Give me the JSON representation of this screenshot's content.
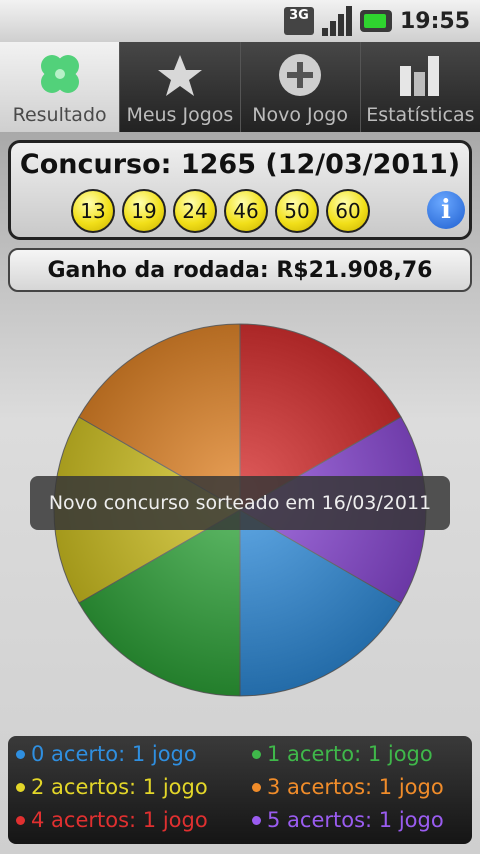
{
  "status_bar": {
    "network": "3G",
    "time": "19:55"
  },
  "tabs": [
    {
      "label": "Resultado",
      "icon": "clover-icon",
      "active": true
    },
    {
      "label": "Meus Jogos",
      "icon": "star-icon",
      "active": false
    },
    {
      "label": "Novo Jogo",
      "icon": "plus-icon",
      "active": false
    },
    {
      "label": "Estatísticas",
      "icon": "bar-chart-icon",
      "active": false
    }
  ],
  "result": {
    "concurso": "Concurso: 1265 (12/03/2011)",
    "numbers": [
      "13",
      "19",
      "24",
      "46",
      "50",
      "60"
    ],
    "ganho": "Ganho da rodada: R$21.908,76"
  },
  "toast": "Novo concurso sorteado em 16/03/2011",
  "chart_data": {
    "type": "pie",
    "categories": [
      "0 acerto",
      "1 acerto",
      "2 acertos",
      "3 acertos",
      "4 acertos",
      "5 acertos"
    ],
    "values": [
      1,
      1,
      1,
      1,
      1,
      1
    ],
    "colors": [
      "#2f8fe0",
      "#2fa83a",
      "#d4c51e",
      "#e07f1e",
      "#d42424",
      "#8a46d8"
    ]
  },
  "legend": [
    {
      "text": "0 acerto: 1 jogo",
      "color": "#2f8fe0"
    },
    {
      "text": "1 acerto: 1 jogo",
      "color": "#3fb84a"
    },
    {
      "text": "2 acertos: 1 jogo",
      "color": "#e3d629"
    },
    {
      "text": "3 acertos: 1 jogo",
      "color": "#f08c2a"
    },
    {
      "text": "4 acertos: 1 jogo",
      "color": "#e03030"
    },
    {
      "text": "5 acertos: 1 jogo",
      "color": "#9a5cf0"
    }
  ]
}
